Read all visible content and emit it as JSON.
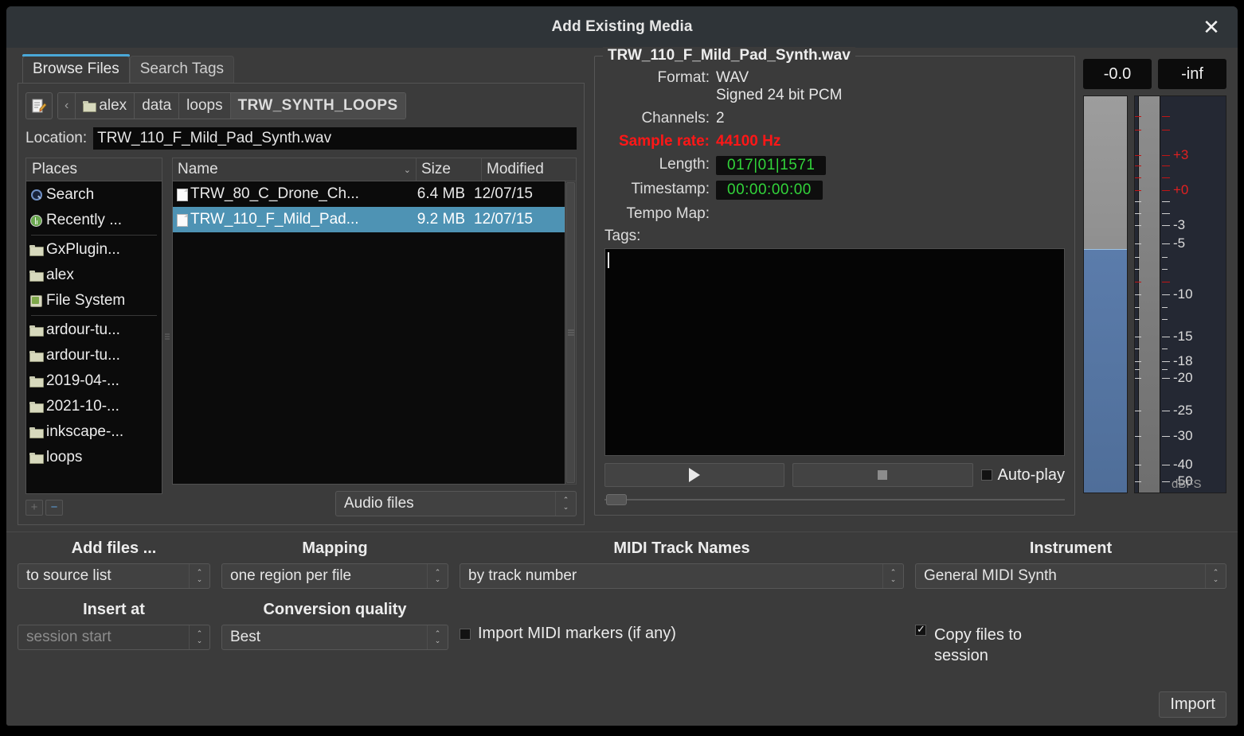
{
  "window": {
    "title": "Add Existing Media",
    "close_label": "✕"
  },
  "tabs": [
    {
      "label": "Browse Files",
      "active": true
    },
    {
      "label": "Search Tags",
      "active": false
    }
  ],
  "pathbar": {
    "edit_icon": "path-edit-icon",
    "back_label": "‹",
    "crumbs": [
      "alex",
      "data",
      "loops",
      "TRW_SYNTH_LOOPS"
    ],
    "current": "TRW_SYNTH_LOOPS"
  },
  "location": {
    "label": "Location:",
    "value": "TRW_110_F_Mild_Pad_Synth.wav"
  },
  "places": {
    "header": "Places",
    "items": [
      {
        "label": "Search",
        "icon": "search-icon"
      },
      {
        "label": "Recently ...",
        "icon": "recent-icon"
      },
      {
        "label": "GxPlugin...",
        "icon": "folder-icon"
      },
      {
        "label": "alex",
        "icon": "folder-icon"
      },
      {
        "label": "File System",
        "icon": "disk-icon"
      },
      {
        "label": "ardour-tu...",
        "icon": "folder-icon"
      },
      {
        "label": "ardour-tu...",
        "icon": "folder-icon"
      },
      {
        "label": "2019-04-...",
        "icon": "folder-icon"
      },
      {
        "label": "2021-10-...",
        "icon": "folder-icon"
      },
      {
        "label": "inkscape-...",
        "icon": "folder-icon"
      },
      {
        "label": "loops",
        "icon": "folder-icon"
      }
    ],
    "add_label": "+",
    "remove_label": "−"
  },
  "file_table": {
    "columns": [
      "Name",
      "Size",
      "Modified"
    ],
    "sort_caret": "⌄",
    "rows": [
      {
        "name": "TRW_80_C_Drone_Ch...",
        "size": "6.4 MB",
        "modified": "12/07/15",
        "selected": false
      },
      {
        "name": "TRW_110_F_Mild_Pad...",
        "size": "9.2 MB",
        "modified": "12/07/15",
        "selected": true
      }
    ]
  },
  "filter": {
    "value": "Audio files"
  },
  "file_info": {
    "title": "TRW_110_F_Mild_Pad_Synth.wav",
    "format_label": "Format:",
    "format_value_line1": "WAV",
    "format_value_line2": "Signed 24 bit PCM",
    "channels_label": "Channels:",
    "channels_value": "2",
    "sample_rate_label": "Sample rate:",
    "sample_rate_value": "44100 Hz",
    "length_label": "Length:",
    "length_value": "017|01|1571",
    "timestamp_label": "Timestamp:",
    "timestamp_value": "00:00:00:00",
    "tempo_map_label": "Tempo Map:",
    "tempo_map_value": "",
    "tags_label": "Tags:",
    "tags_value": ""
  },
  "transport": {
    "play_icon": "play-icon",
    "stop_icon": "stop-icon",
    "autoplay_label": "Auto-play",
    "autoplay_checked": false
  },
  "meter": {
    "gain_value": "-0.0",
    "peak_value": "-inf",
    "unit_label": "dBFS",
    "scale": [
      {
        "label": "+3",
        "pos": 14.8,
        "color": "red",
        "major": true
      },
      {
        "label": "+0",
        "pos": 23.6,
        "color": "red",
        "major": true
      },
      {
        "label": "-3",
        "pos": 32.6,
        "color": "white",
        "major": true
      },
      {
        "label": "-5",
        "pos": 37.2,
        "color": "white",
        "major": true
      },
      {
        "label": "-10",
        "pos": 50.0,
        "color": "white",
        "major": true
      },
      {
        "label": "-15",
        "pos": 60.7,
        "color": "white",
        "major": true
      },
      {
        "label": "-18",
        "pos": 66.8,
        "color": "white",
        "major": true
      },
      {
        "label": "-20",
        "pos": 71.0,
        "color": "white",
        "major": true
      },
      {
        "label": "-25",
        "pos": 79.3,
        "color": "white",
        "major": true
      },
      {
        "label": "-30",
        "pos": 85.8,
        "color": "white",
        "major": true
      },
      {
        "label": "-40",
        "pos": 92.9,
        "color": "white",
        "major": true
      },
      {
        "label": "-50",
        "pos": 97.1,
        "color": "white",
        "major": true
      }
    ],
    "fader_fill_pct": 61.5
  },
  "options": {
    "add_files": {
      "title": "Add files ...",
      "value": "to source list"
    },
    "mapping": {
      "title": "Mapping",
      "value": "one region per file"
    },
    "midi_track_names": {
      "title": "MIDI Track Names",
      "value": "by track number"
    },
    "instrument": {
      "title": "Instrument",
      "value": "General MIDI Synth"
    },
    "insert_at": {
      "title": "Insert at",
      "value": "session start"
    },
    "conversion_quality": {
      "title": "Conversion quality",
      "value": "Best"
    },
    "import_midi_markers": {
      "label": "Import MIDI markers (if any)",
      "checked": false
    },
    "copy_files": {
      "label": "Copy files to session",
      "checked": true
    }
  },
  "footer": {
    "import_label": "Import"
  },
  "colors": {
    "accent": "#4aa8d8",
    "selection": "#4e93b4",
    "alert": "#ff1717",
    "clock_text": "#32d43a",
    "fader": "#4f6e99"
  }
}
